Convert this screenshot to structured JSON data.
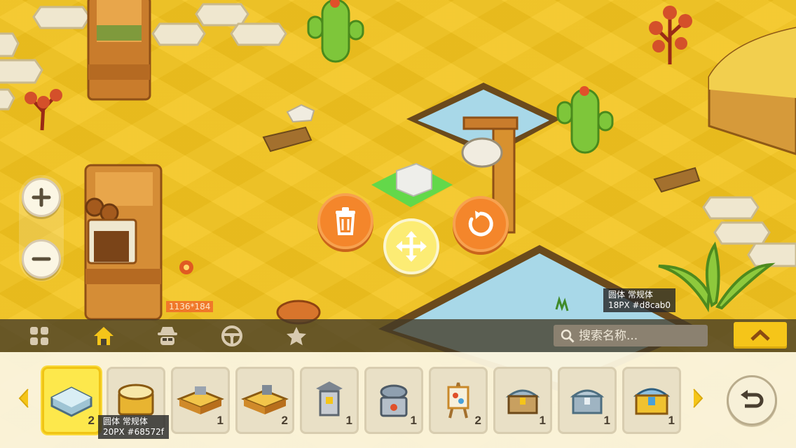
{
  "zoom": {
    "in_icon": "plus-icon",
    "out_icon": "minus-icon"
  },
  "selection_actions": {
    "delete_icon": "trash-icon",
    "move_icon": "move-arrows-icon",
    "rotate_icon": "rotate-icon"
  },
  "annotations": {
    "size_marker": "1136*184",
    "search_font_note": {
      "line1": "圆体 常规体",
      "line2": "18PX  #d8cab0"
    },
    "count_font_note": {
      "line1": "圆体 常规体",
      "line2": "20PX  #68572f"
    }
  },
  "toolbar": {
    "tabs": [
      {
        "name": "all",
        "icon": "grid-icon"
      },
      {
        "name": "home",
        "icon": "house-icon"
      },
      {
        "name": "character",
        "icon": "disguise-face-icon"
      },
      {
        "name": "vehicle",
        "icon": "steering-wheel-icon"
      },
      {
        "name": "favorites",
        "icon": "star-icon"
      }
    ],
    "active_tab": "home",
    "search_placeholder": "搜索名称...",
    "collapse_icon": "chevron-up-icon"
  },
  "tray": {
    "items": [
      {
        "name": "glass-display-case",
        "count": "2",
        "selected": true
      },
      {
        "name": "golden-treasure-case",
        "count": ""
      },
      {
        "name": "craft-workbench",
        "count": "1"
      },
      {
        "name": "tool-workbench",
        "count": "2"
      },
      {
        "name": "stone-lantern",
        "count": "1"
      },
      {
        "name": "cooking-stove",
        "count": "1"
      },
      {
        "name": "painting-easel",
        "count": "2"
      },
      {
        "name": "wooden-chest",
        "count": "1"
      },
      {
        "name": "silver-chest",
        "count": "1"
      },
      {
        "name": "gold-chest",
        "count": "1"
      }
    ],
    "prev_icon": "caret-left-icon",
    "next_icon": "caret-right-icon",
    "back_icon": "undo-arrow-icon"
  },
  "colors": {
    "accent": "#f5c519",
    "action_orange": "#f4862b",
    "count_text": "#68572f",
    "search_text": "#d8cab0"
  }
}
